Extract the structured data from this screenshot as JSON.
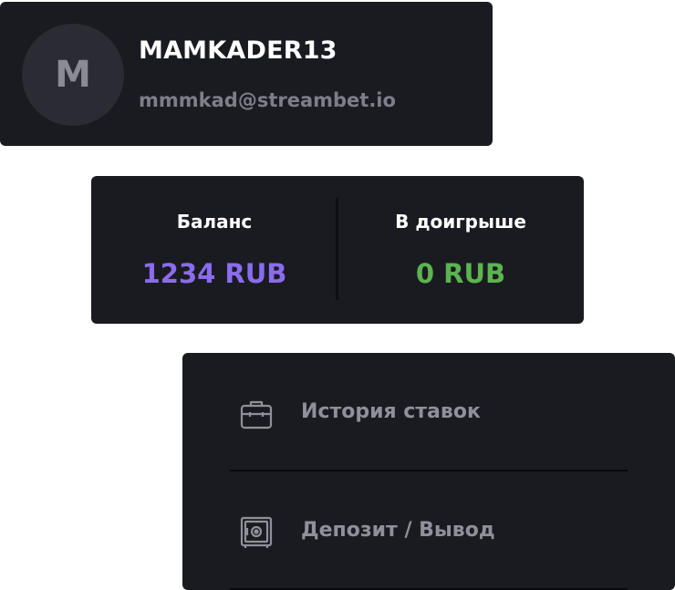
{
  "profile": {
    "avatar_letter": "M",
    "username": "MAMKADER13",
    "email": "mmmkad@streambet.io"
  },
  "balance": {
    "main_label": "Баланс",
    "main_value": "1234 RUB",
    "main_color": "#8b6cf0",
    "bonus_label": "В доигрыше",
    "bonus_value": "0 RUB",
    "bonus_color": "#5bb450"
  },
  "menu": {
    "items": [
      {
        "label": "История ставок",
        "icon": "briefcase-icon"
      },
      {
        "label": "Депозит / Вывод",
        "icon": "safe-icon"
      }
    ]
  },
  "colors": {
    "card_bg": "#1a1b21",
    "muted_text": "#8f9099",
    "avatar_bg": "#2b2c33"
  }
}
